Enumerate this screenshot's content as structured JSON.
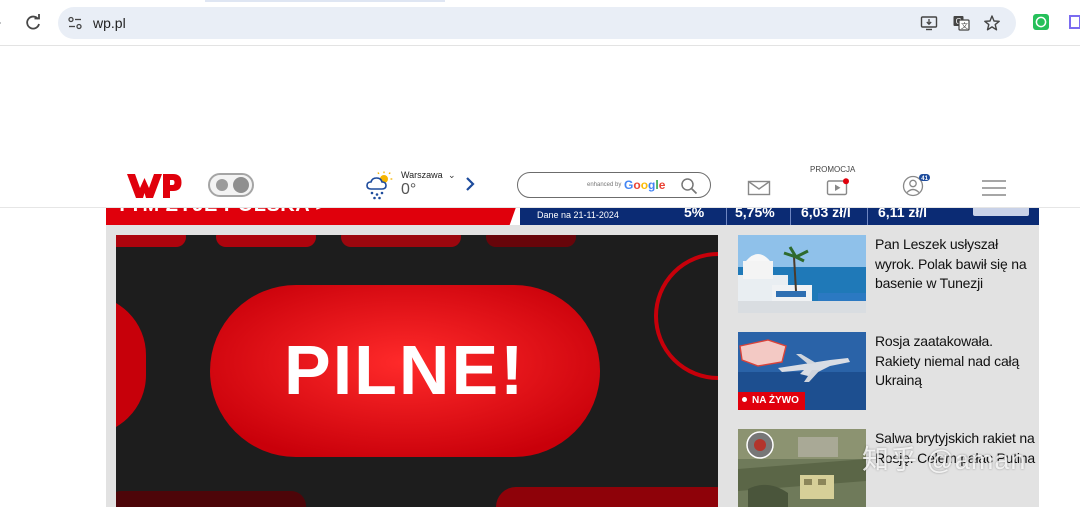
{
  "browser": {
    "url": "wp.pl"
  },
  "header": {
    "weather": {
      "city": "Warszawa",
      "temperature": "0°"
    },
    "search": {
      "enhanced_label": "enhanced by",
      "brand": "Google"
    },
    "promo_label": "PROMOCJA",
    "icons": [
      "logo",
      "theme-toggle",
      "weather-icon",
      "search-icon",
      "mail-icon",
      "video-icon",
      "user-icon",
      "menu-icon"
    ]
  },
  "ticker": {
    "title": "TYM ŻYJE POLSKA >",
    "date_label": "Dane na 21-11-2024",
    "values": [
      "5%",
      "5,75%",
      "6,03 zł/l",
      "6,11 zł/l"
    ]
  },
  "hero": {
    "headline": "PILNE!"
  },
  "articles": [
    {
      "title": "Pan Leszek usłyszał wyrok. Polak bawił się na basenie w Tunezji"
    },
    {
      "title": "Rosja zaatakowała. Rakiety niemal nad całą Ukrainą",
      "badge": "NA ŻYWO"
    },
    {
      "title": "Salwa brytyjskich rakiet na Rosję. Celem pałac Putina"
    }
  ],
  "watermark": "知乎 @aman",
  "colors": {
    "brand_red": "#e0000c",
    "ticker_blue": "#0b2b74",
    "content_bg": "#e2e2e2"
  }
}
